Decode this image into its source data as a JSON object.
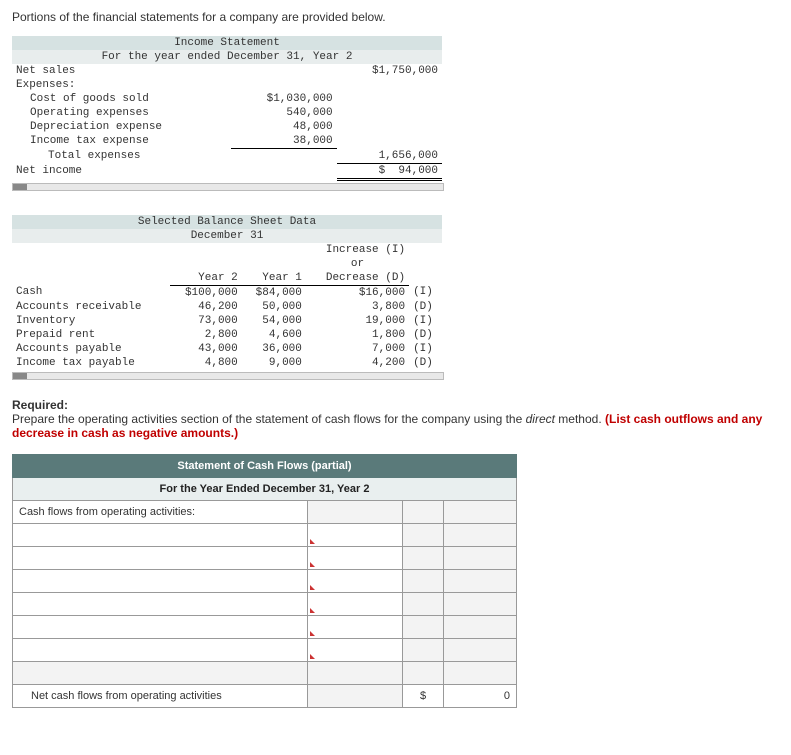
{
  "intro": "Portions of the financial statements for a company are provided below.",
  "income_statement": {
    "title": "Income Statement",
    "subtitle": "For the year ended December 31, Year 2",
    "lines": {
      "net_sales_label": "Net sales",
      "net_sales_amount": "$1,750,000",
      "expenses_label": "Expenses:",
      "cogs_label": "Cost of goods sold",
      "cogs_amount": "$1,030,000",
      "opex_label": "Operating expenses",
      "opex_amount": "540,000",
      "dep_label": "Depreciation expense",
      "dep_amount": "48,000",
      "tax_label": "Income tax expense",
      "tax_amount": "38,000",
      "total_exp_label": "Total expenses",
      "total_exp_amount": "1,656,000",
      "net_income_label": "Net income",
      "net_income_cur": "$",
      "net_income_amount": "94,000"
    }
  },
  "balance_sheet": {
    "title": "Selected Balance Sheet Data",
    "subtitle": "December 31",
    "col_y2": "Year 2",
    "col_y1": "Year 1",
    "col_inc1": "Increase (I)",
    "col_inc2": "or",
    "col_inc3": "Decrease (D)",
    "rows": [
      {
        "label": "Cash",
        "y2": "$100,000",
        "y1": "$84,000",
        "chg": "$16,000",
        "id": "(I)"
      },
      {
        "label": "Accounts receivable",
        "y2": "46,200",
        "y1": "50,000",
        "chg": "3,800",
        "id": "(D)"
      },
      {
        "label": "Inventory",
        "y2": "73,000",
        "y1": "54,000",
        "chg": "19,000",
        "id": "(I)"
      },
      {
        "label": "Prepaid rent",
        "y2": "2,800",
        "y1": "4,600",
        "chg": "1,800",
        "id": "(D)"
      },
      {
        "label": "Accounts payable",
        "y2": "43,000",
        "y1": "36,000",
        "chg": "7,000",
        "id": "(I)"
      },
      {
        "label": "Income tax payable",
        "y2": "4,800",
        "y1": "9,000",
        "chg": "4,200",
        "id": "(D)"
      }
    ]
  },
  "required": {
    "heading": "Required:",
    "text1": "Prepare the operating activities section of the statement of cash flows for the company using the ",
    "em": "direct",
    "text2": " method. ",
    "red": "(List cash outflows and any decrease in cash as negative amounts.)"
  },
  "answer": {
    "title": "Statement of Cash Flows (partial)",
    "subtitle": "For the Year Ended December 31, Year 2",
    "section": "Cash flows from operating activities:",
    "footer": "Net cash flows from operating activities",
    "cur": "$",
    "total": "0"
  }
}
